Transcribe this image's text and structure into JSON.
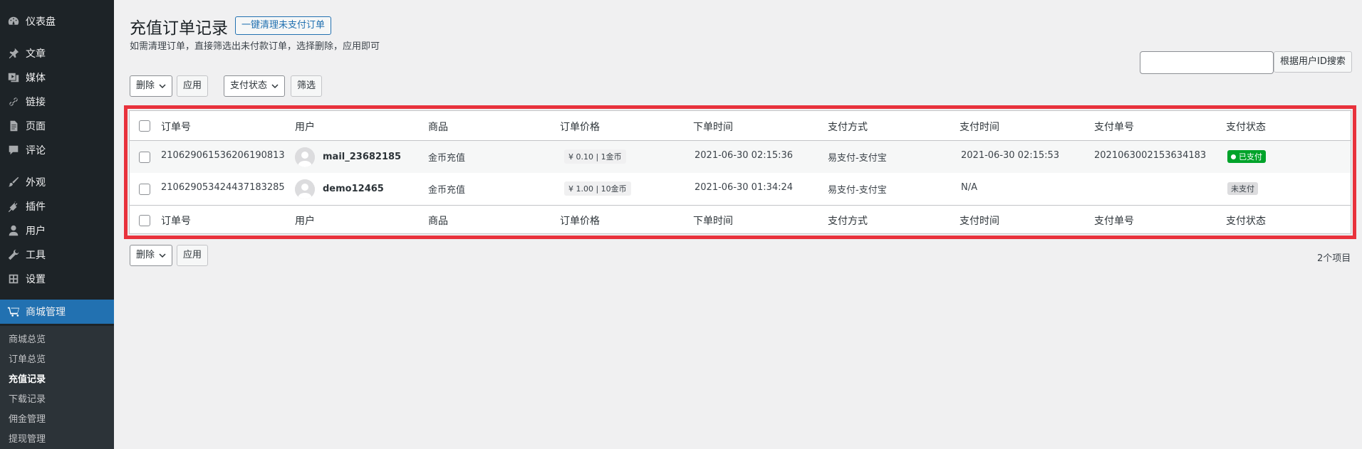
{
  "sidebar": {
    "items": [
      {
        "label": "仪表盘",
        "icon": "dashboard-icon"
      },
      {
        "label": "文章",
        "icon": "pin-icon"
      },
      {
        "label": "媒体",
        "icon": "media-icon"
      },
      {
        "label": "链接",
        "icon": "link-icon"
      },
      {
        "label": "页面",
        "icon": "page-icon"
      },
      {
        "label": "评论",
        "icon": "comment-icon"
      },
      {
        "label": "外观",
        "icon": "brush-icon"
      },
      {
        "label": "插件",
        "icon": "plugin-icon"
      },
      {
        "label": "用户",
        "icon": "user-icon"
      },
      {
        "label": "工具",
        "icon": "wrench-icon"
      },
      {
        "label": "设置",
        "icon": "settings-icon"
      },
      {
        "label": "商城管理",
        "icon": "cart-icon"
      }
    ],
    "submenu": [
      "商城总览",
      "订单总览",
      "充值记录",
      "下载记录",
      "佣金管理",
      "提现管理"
    ],
    "current_submenu": "充值记录"
  },
  "page": {
    "title": "充值订单记录",
    "action_button": "一键清理未支付订单",
    "description": "如需清理订单，直接筛选出未付款订单，选择删除，应用即可"
  },
  "search": {
    "button": "根据用户ID搜索",
    "value": ""
  },
  "bulk_actions": {
    "select": "删除",
    "apply": "应用"
  },
  "filters": {
    "status_select": "支付状态",
    "filter_button": "筛选"
  },
  "table": {
    "columns": [
      "订单号",
      "用户",
      "商品",
      "订单价格",
      "下单时间",
      "支付方式",
      "支付时间",
      "支付单号",
      "支付状态"
    ],
    "rows": [
      {
        "order_no": "210629061536206190813",
        "user": "mail_23682185",
        "product": "金币充值",
        "price": "¥ 0.10 | 1金币",
        "order_time": "2021-06-30 02:15:36",
        "pay_method": "易支付-支付宝",
        "pay_time": "2021-06-30 02:15:53",
        "pay_no": "2021063002153634183",
        "status": "已支付"
      },
      {
        "order_no": "210629053424437183285",
        "user": "demo12465",
        "product": "金币充值",
        "price": "¥ 1.00 | 10金币",
        "order_time": "2021-06-30 01:34:24",
        "pay_method": "易支付-支付宝",
        "pay_time": "N/A",
        "pay_no": "",
        "status": "未支付"
      }
    ]
  },
  "item_count": "2个项目",
  "colors": {
    "sidebar_bg": "#1d2327",
    "accent": "#2271b1",
    "highlight_border": "#e8323c",
    "paid_green": "#00a32a"
  }
}
